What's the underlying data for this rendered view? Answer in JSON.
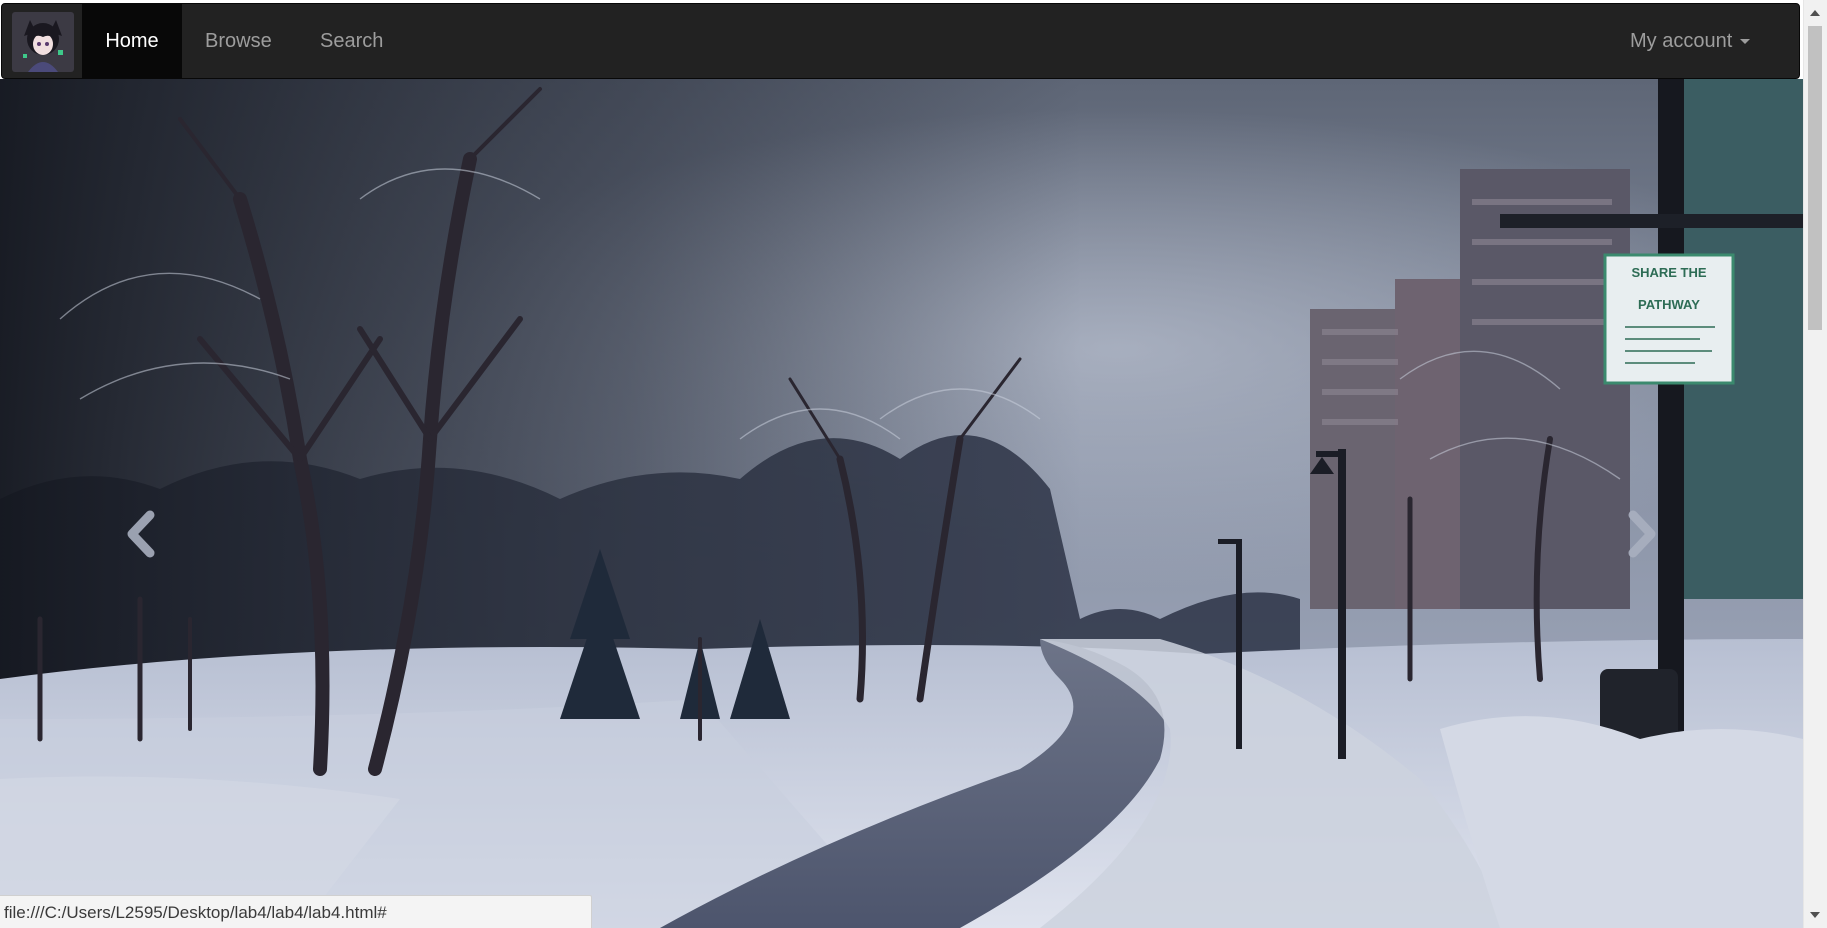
{
  "navbar": {
    "brand_icon": "anime-avatar-logo",
    "items": [
      {
        "label": "Home",
        "active": true
      },
      {
        "label": "Browse",
        "active": false
      },
      {
        "label": "Search",
        "active": false
      }
    ],
    "account_label": "My account",
    "colors": {
      "background": "#222222",
      "active": "#080808",
      "text": "#9d9d9d",
      "active_text": "#ffffff"
    }
  },
  "carousel": {
    "slide_image": "winter-snowy-park-path",
    "prev_icon": "chevron-left-icon",
    "next_icon": "chevron-right-icon",
    "sign_text": [
      "SHARE THE",
      "PATHWAY"
    ]
  },
  "status_bar": {
    "url": "file:///C:/Users/L2595/Desktop/lab4/lab4/lab4.html#"
  }
}
